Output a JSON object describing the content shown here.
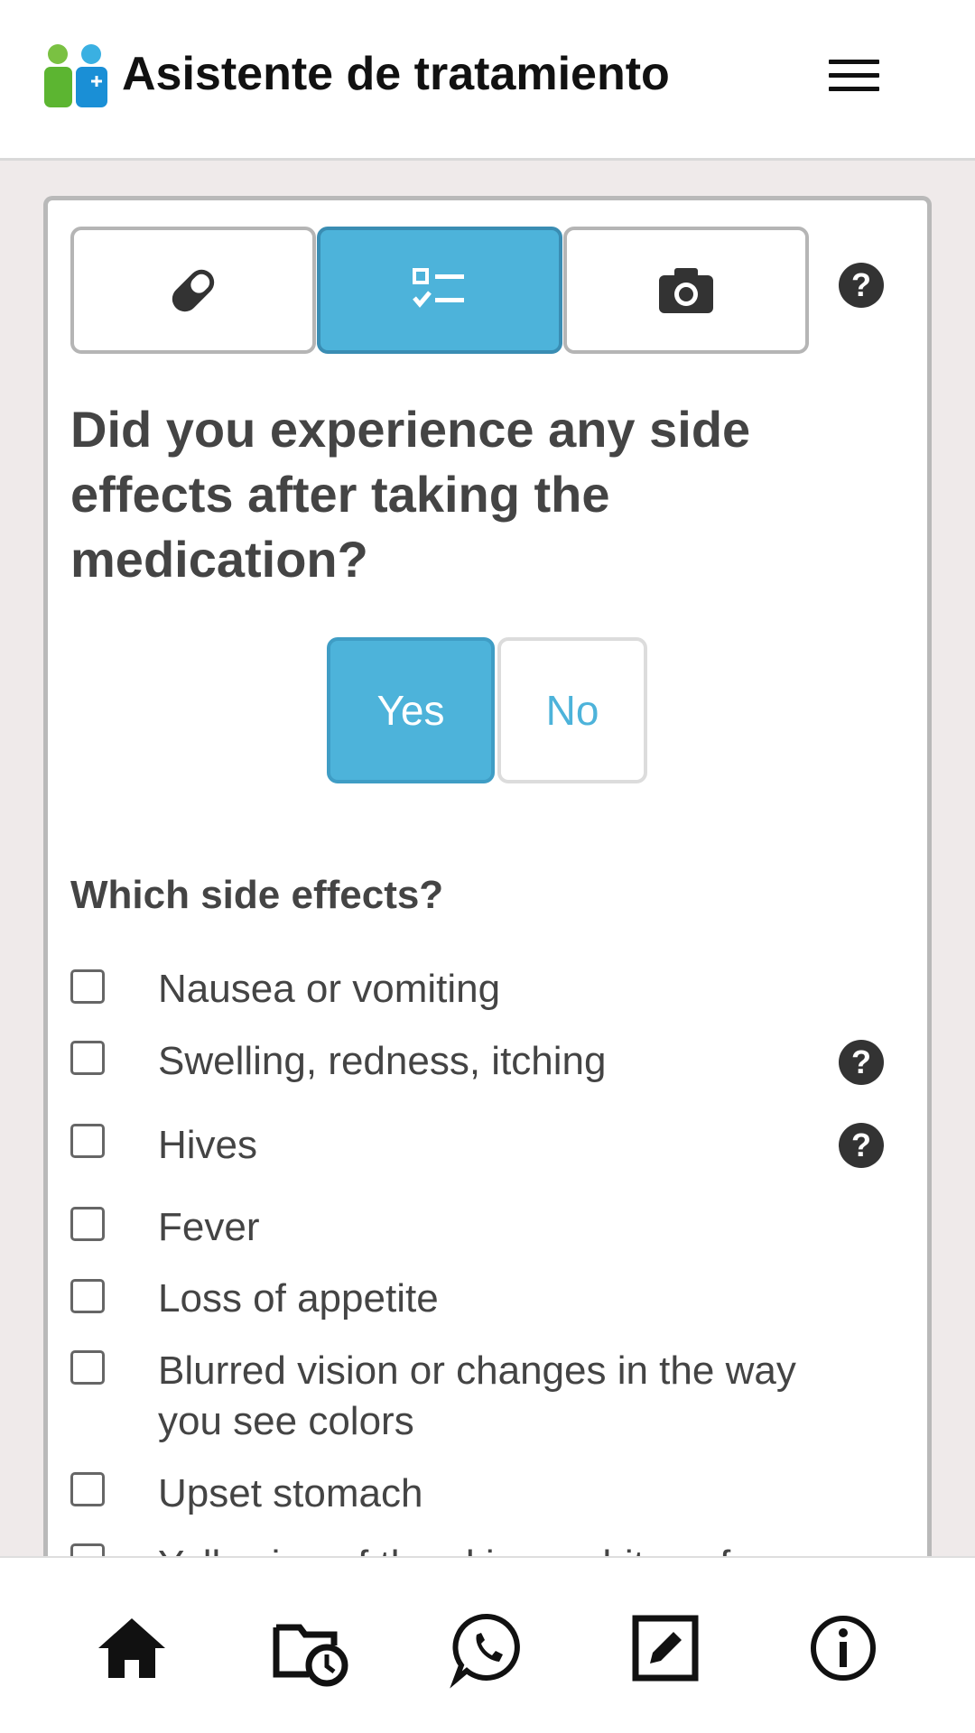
{
  "header": {
    "title": "Asistente de tratamiento",
    "logo_icon": "people-plus-icon",
    "menu_icon": "hamburger-menu-icon"
  },
  "tabs": [
    {
      "icon": "pill-icon",
      "active": false
    },
    {
      "icon": "checklist-icon",
      "active": true
    },
    {
      "icon": "camera-icon",
      "active": false
    }
  ],
  "question": "Did you experience any side effects after taking the medication?",
  "answers": {
    "yes_label": "Yes",
    "no_label": "No",
    "selected": "Yes"
  },
  "side_effects": {
    "heading": "Which side effects?",
    "options": [
      {
        "label": "Nausea or vomiting",
        "checked": false,
        "has_help": false
      },
      {
        "label": "Swelling, redness, itching",
        "checked": false,
        "has_help": true
      },
      {
        "label": "Hives",
        "checked": false,
        "has_help": true
      },
      {
        "label": "Fever",
        "checked": false,
        "has_help": false
      },
      {
        "label": "Loss of appetite",
        "checked": false,
        "has_help": false
      },
      {
        "label": "Blurred vision or changes in the way you see colors",
        "checked": false,
        "has_help": false
      },
      {
        "label": "Upset stomach",
        "checked": false,
        "has_help": false
      },
      {
        "label": "Yellowing of the skin or whites of",
        "checked": false,
        "has_help": false
      }
    ]
  },
  "bottom_nav": [
    "home-icon",
    "calendar-clock-icon",
    "whatsapp-icon",
    "edit-icon",
    "info-icon"
  ],
  "colors": {
    "accent": "#4db3da",
    "text": "#444444",
    "background": "#efeaea"
  }
}
